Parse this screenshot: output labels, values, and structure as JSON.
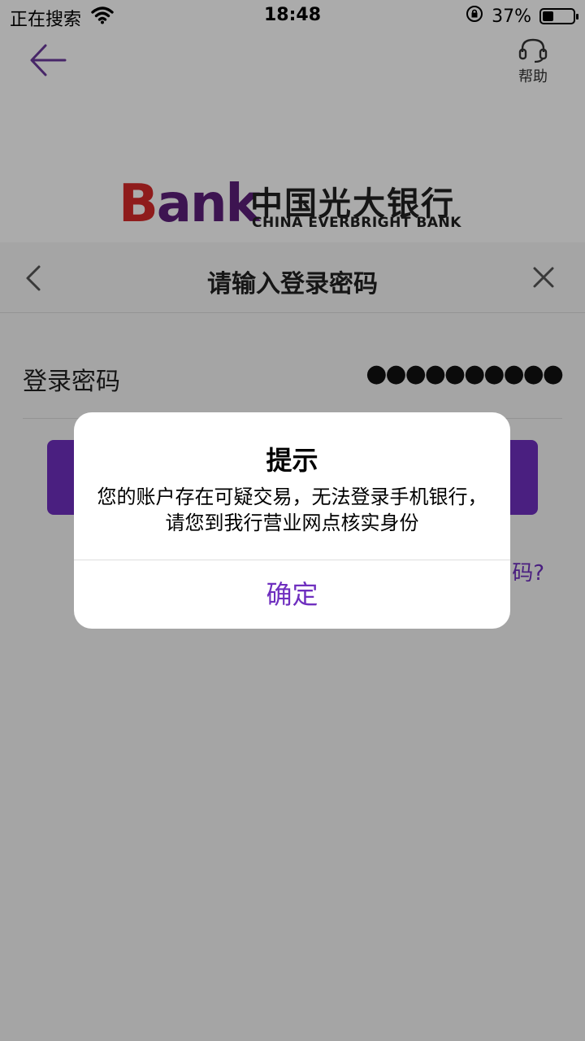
{
  "status_bar": {
    "carrier": "正在搜索",
    "time": "18:48",
    "battery": "37%",
    "battery_level": 0.37
  },
  "header": {
    "help_label": "帮助"
  },
  "logo": {
    "bank_b": "B",
    "bank_rest": "ank",
    "cn_name": "中国光大银行",
    "en_name": "CHINA EVERBRIGHT BANK"
  },
  "sheet": {
    "title": "请输入登录密码",
    "password_label": "登录密码",
    "password_value": "●●●●●●●●●●",
    "forgot_partial": "码?"
  },
  "alert": {
    "title": "提示",
    "message": "您的账户存在可疑交易，无法登录手机银行，请您到我行营业网点核实身份",
    "ok_label": "确定"
  },
  "colors": {
    "brand_purple": "#6f2fbf",
    "logo_red": "#d62a2a"
  }
}
